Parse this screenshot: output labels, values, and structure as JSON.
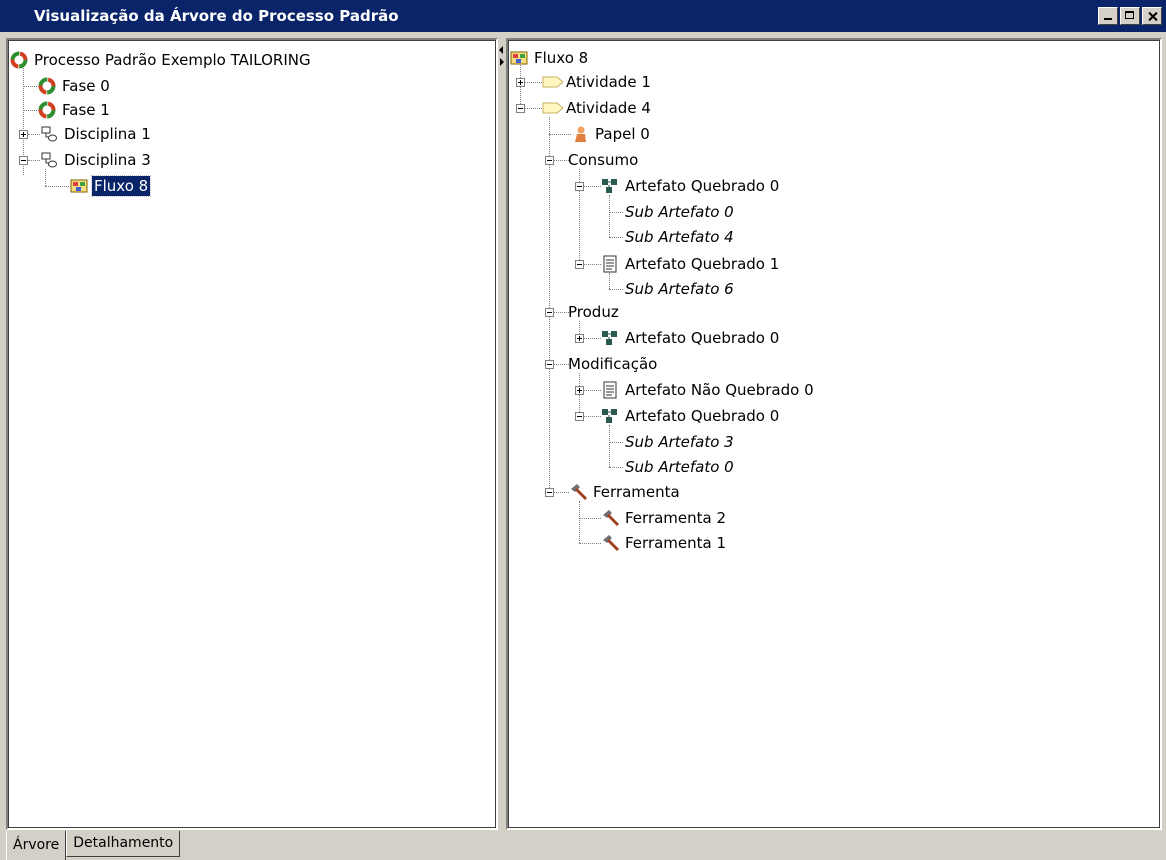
{
  "window": {
    "title": "Visualização da Árvore do Processo Padrão",
    "buttons": {
      "minimize": "_",
      "maximize": "□",
      "close": "×"
    }
  },
  "left_tree": {
    "root": "Processo Padrão Exemplo TAILORING",
    "fase0": "Fase 0",
    "fase1": "Fase 1",
    "disciplina1": "Disciplina 1",
    "disciplina3": "Disciplina 3",
    "fluxo8": "Fluxo 8"
  },
  "right_tree": {
    "root": "Fluxo 8",
    "atividade1": "Atividade 1",
    "atividade4": "Atividade 4",
    "papel0": "Papel 0",
    "consumo": "Consumo",
    "consumo_aq0": "Artefato Quebrado 0",
    "consumo_sub0": "Sub Artefato 0",
    "consumo_sub4": "Sub Artefato 4",
    "consumo_aq1": "Artefato Quebrado 1",
    "consumo_sub6": "Sub Artefato 6",
    "produz": "Produz",
    "produz_aq0": "Artefato Quebrado 0",
    "modificacao": "Modificação",
    "mod_anq0": "Artefato Não Quebrado 0",
    "mod_aq0": "Artefato Quebrado 0",
    "mod_sub3": "Sub Artefato 3",
    "mod_sub0": "Sub Artefato 0",
    "ferramenta": "Ferramenta",
    "ferramenta2": "Ferramenta 2",
    "ferramenta1": "Ferramenta 1"
  },
  "tabs": {
    "arvore": "Árvore",
    "detalhamento": "Detalhamento"
  }
}
